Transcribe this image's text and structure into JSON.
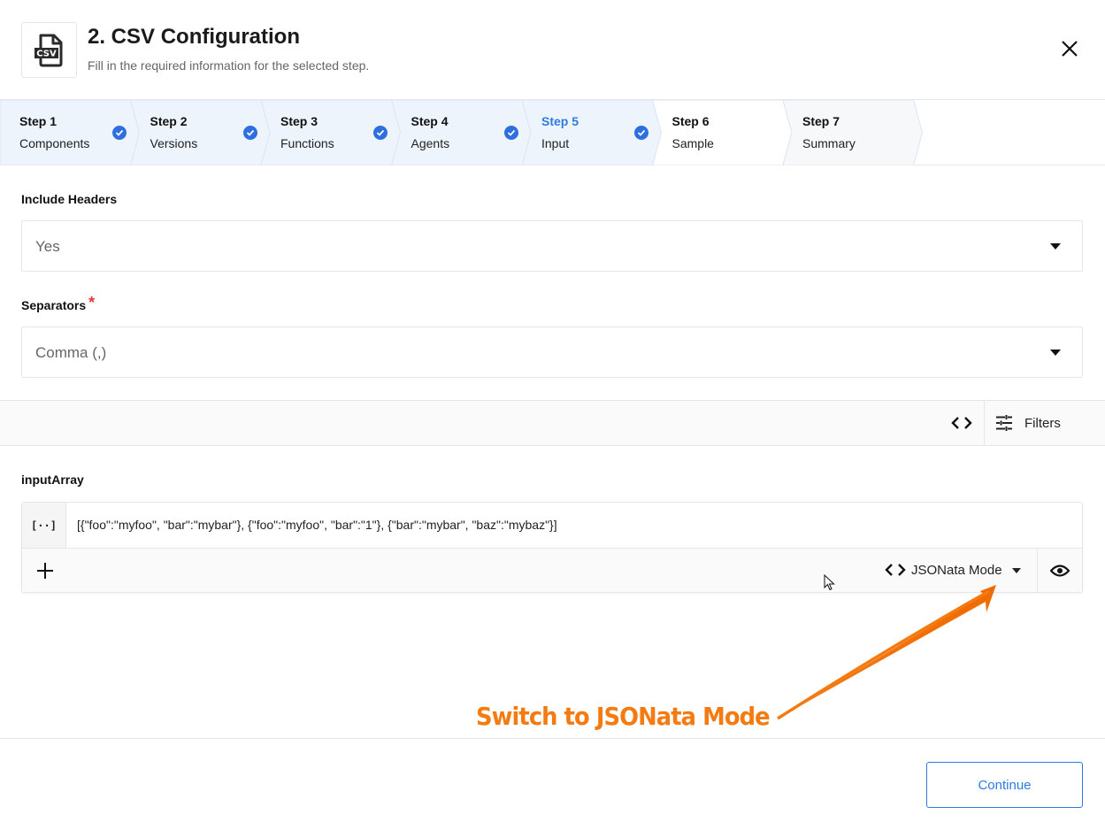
{
  "header": {
    "icon": "csv-file-icon",
    "title": "2. CSV Configuration",
    "subtitle": "Fill in the required information for the selected step.",
    "close_icon": "close-icon"
  },
  "stepper": {
    "steps": [
      {
        "number": "Step 1",
        "label": "Components",
        "completed": true,
        "active": false
      },
      {
        "number": "Step 2",
        "label": "Versions",
        "completed": true,
        "active": false
      },
      {
        "number": "Step 3",
        "label": "Functions",
        "completed": true,
        "active": false
      },
      {
        "number": "Step 4",
        "label": "Agents",
        "completed": true,
        "active": false
      },
      {
        "number": "Step 5",
        "label": "Input",
        "completed": true,
        "active": true
      },
      {
        "number": "Step 6",
        "label": "Sample",
        "completed": false,
        "active": false
      },
      {
        "number": "Step 7",
        "label": "Summary",
        "completed": false,
        "active": false
      }
    ],
    "colors": {
      "completed_bg": "#eef4fc",
      "active_text": "#2e7be0",
      "check": "#2e6fe0",
      "pending_bg": "#f7f8fa"
    }
  },
  "form": {
    "include_headers": {
      "label": "Include Headers",
      "value": "Yes"
    },
    "separators": {
      "label": "Separators",
      "required_mark": "*",
      "value": "Comma (,)"
    }
  },
  "toolbar": {
    "code_icon": "code-brackets-icon",
    "filters_label": "Filters",
    "filters_icon": "sliders-icon"
  },
  "input_array": {
    "label": "inputArray",
    "type_badge": "[··]",
    "value": "[{\"foo\":\"myfoo\", \"bar\":\"mybar\"}, {\"foo\":\"myfoo\", \"bar\":\"1\"}, {\"bar\":\"mybar\", \"baz\":\"mybaz\"}]",
    "add_icon": "plus-icon",
    "mode_label": "JSONata Mode",
    "preview_icon": "eye-icon"
  },
  "annotation": {
    "text": "Switch to JSONata Mode",
    "color": "#f47b12"
  },
  "footer": {
    "continue_label": "Continue",
    "accent": "#2e7be0"
  }
}
